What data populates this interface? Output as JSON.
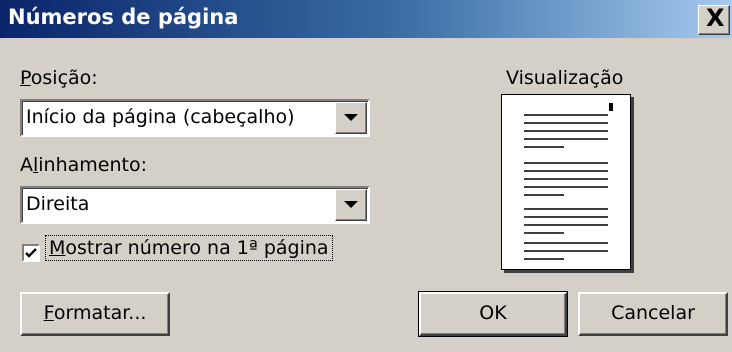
{
  "dialog": {
    "title": "Números de página",
    "close_glyph": "X"
  },
  "position": {
    "label_prefix": "",
    "label_access": "P",
    "label_rest": "osição:",
    "value": "Início da página (cabeçalho)"
  },
  "alignment": {
    "label_prefix": "A",
    "label_access": "l",
    "label_rest": "inhamento:",
    "value": "Direita"
  },
  "show_first_page": {
    "checked": true,
    "label_access": "M",
    "label_rest": "ostrar número na 1ª página"
  },
  "preview": {
    "label": "Visualização"
  },
  "buttons": {
    "format_access": "F",
    "format_rest": "ormatar...",
    "ok": "OK",
    "cancel": "Cancelar"
  }
}
